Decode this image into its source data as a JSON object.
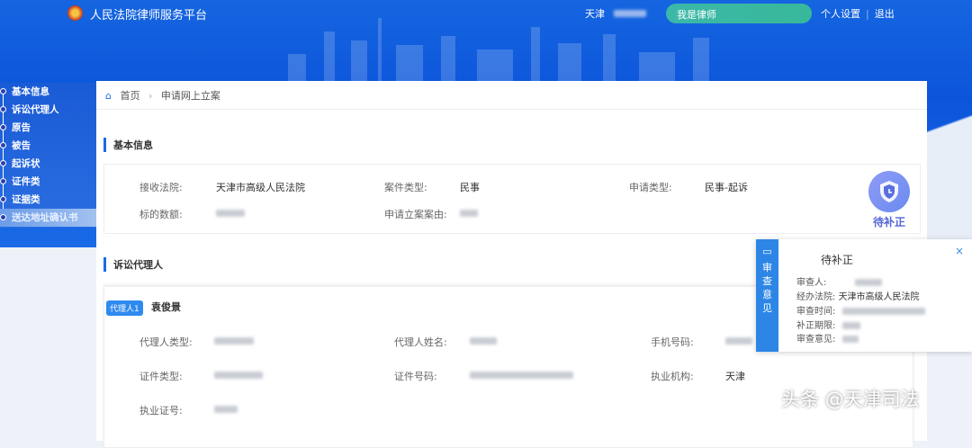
{
  "header": {
    "brand": "人民法院律师服务平台",
    "city": "天津",
    "role_button": "我是律师",
    "settings": "个人设置",
    "logout": "退出"
  },
  "sidebar": {
    "items": [
      "基本信息",
      "诉讼代理人",
      "原告",
      "被告",
      "起诉状",
      "证件类",
      "证据类",
      "送达地址确认书"
    ]
  },
  "breadcrumb": {
    "home": "首页",
    "current": "申请网上立案"
  },
  "basic": {
    "title": "基本信息",
    "court_label": "接收法院:",
    "court": "天津市高级人民法院",
    "case_type_label": "案件类型:",
    "case_type": "民事",
    "apply_type_label": "申请类型:",
    "apply_type": "民事-起诉",
    "amount_label": "标的数额:",
    "cause_label": "申请立案案由:",
    "status": "待补正"
  },
  "agents": {
    "title": "诉讼代理人",
    "tag": "代理人1",
    "name": "袁俊景",
    "fields": {
      "type": "代理人类型:",
      "agent_name": "代理人姓名:",
      "phone": "手机号码:",
      "id_type": "证件类型:",
      "id_no": "证件号码:",
      "org": "执业机构:",
      "org_value": "天津",
      "license": "执业证号:"
    }
  },
  "review": {
    "tab": "审查意见",
    "title": "待补正",
    "close": "×",
    "reviewer": "审查人:",
    "court_label": "经办法院:",
    "court": "天津市高级人民法院",
    "time": "审查时间:",
    "deadline": "补正期限:",
    "opinion": "审查意见:"
  },
  "watermark": "头条 @天津司法"
}
